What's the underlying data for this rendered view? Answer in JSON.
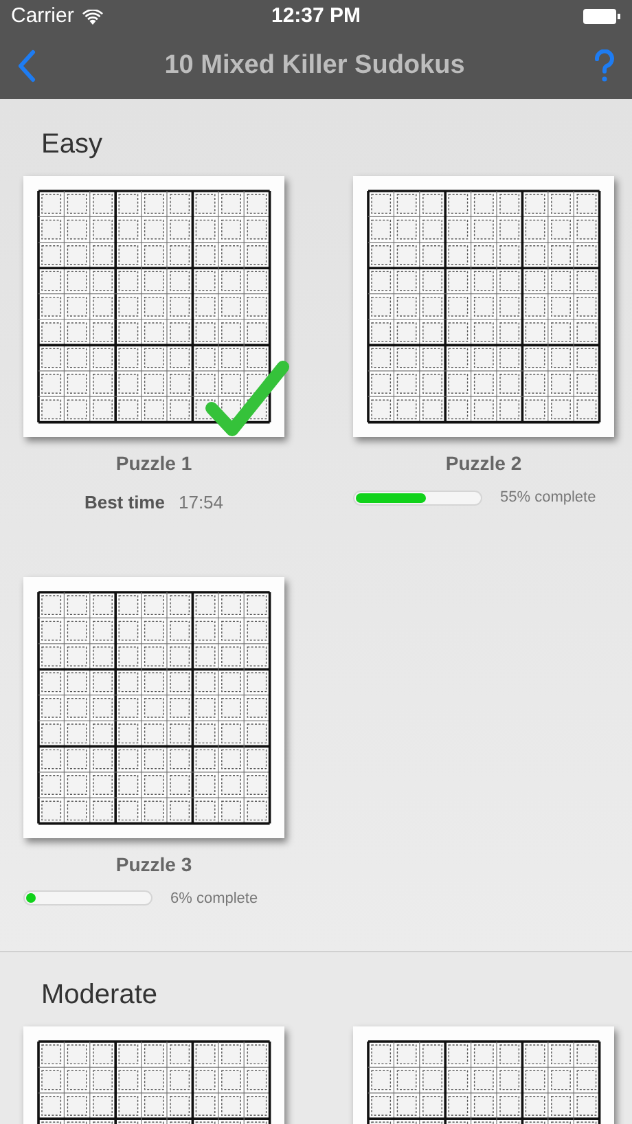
{
  "status_bar": {
    "carrier": "Carrier",
    "time": "12:37 PM"
  },
  "nav": {
    "title": "10 Mixed Killer Sudokus"
  },
  "sections": [
    {
      "title": "Easy",
      "puzzles": [
        {
          "kind": "completed",
          "title": "Puzzle 1",
          "best_time_label": "Best time",
          "best_time": "17:54"
        },
        {
          "kind": "progress",
          "title": "Puzzle 2",
          "level": 0.55,
          "progress_text": "55% complete"
        },
        {
          "kind": "progress",
          "title": "Puzzle 3",
          "level": 0.06,
          "progress_text": "6% complete"
        }
      ]
    },
    {
      "title": "Moderate",
      "puzzles": [
        {
          "kind": "thumbnail"
        },
        {
          "kind": "thumbnail"
        }
      ]
    }
  ]
}
